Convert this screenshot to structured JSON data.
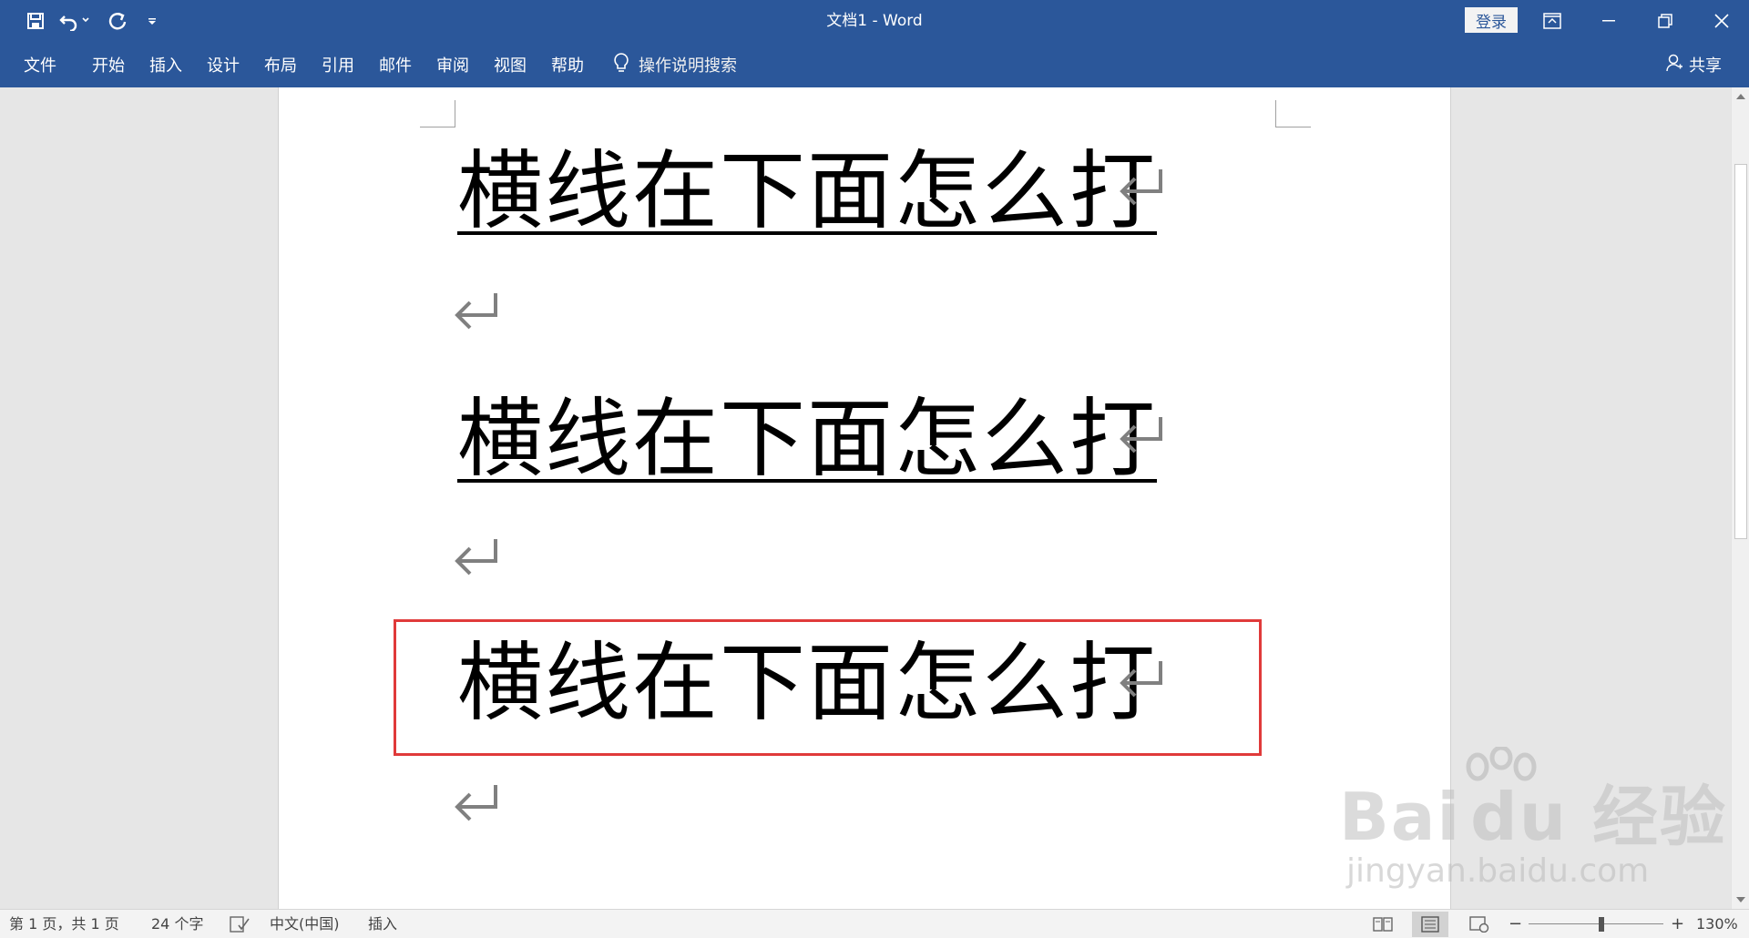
{
  "window": {
    "title": "文档1  -  Word",
    "login_label": "登录"
  },
  "quick_access": {
    "icons": [
      "save-icon",
      "undo-icon",
      "redo-icon",
      "customize-qat-icon"
    ]
  },
  "ribbon": {
    "tabs": [
      "文件",
      "开始",
      "插入",
      "设计",
      "布局",
      "引用",
      "邮件",
      "审阅",
      "视图",
      "帮助"
    ],
    "tell_me": "操作说明搜索",
    "share": "共享"
  },
  "document": {
    "paragraphs": [
      {
        "text": "横线在下面怎么打",
        "underlined": true
      },
      {
        "text": "",
        "underlined": false
      },
      {
        "text": "横线在下面怎么打",
        "underlined": true
      },
      {
        "text": "",
        "underlined": false
      },
      {
        "text": "横线在下面怎么打",
        "underlined": false,
        "highlighted": true
      },
      {
        "text": "",
        "underlined": false
      }
    ],
    "highlight_color": "#e03a3a"
  },
  "status": {
    "page": "第 1 页，共 1 页",
    "word_count": "24 个字",
    "language": "中文(中国)",
    "mode": "插入",
    "zoom_percent": "130%",
    "zoom_value": 130
  },
  "watermark": {
    "logo": "Bai du 经验",
    "url": "jingyan.baidu.com"
  },
  "colors": {
    "brand": "#2b579a",
    "page_bg": "#ffffff",
    "canvas_bg": "#e6e6e6"
  }
}
